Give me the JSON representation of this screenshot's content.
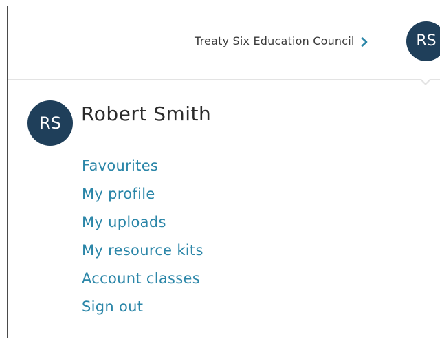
{
  "header": {
    "org_name": "Treaty Six Education Council",
    "avatar_initials": "RS"
  },
  "user_menu": {
    "avatar_initials": "RS",
    "user_name": "Robert Smith",
    "items": [
      {
        "label": "Favourites"
      },
      {
        "label": "My profile"
      },
      {
        "label": "My uploads"
      },
      {
        "label": "My resource kits"
      },
      {
        "label": "Account classes"
      },
      {
        "label": "Sign out"
      }
    ]
  },
  "colors": {
    "avatar_bg": "#1f3f5a",
    "link": "#2b86a8",
    "chevron": "#2b86a8"
  },
  "icons": {
    "org_chevron": "chevron-right-icon"
  }
}
